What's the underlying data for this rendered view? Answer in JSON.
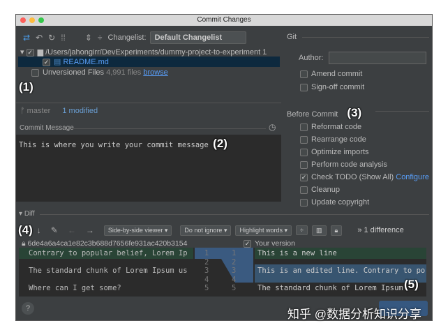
{
  "window": {
    "title": "Commit Changes"
  },
  "toolbar": {
    "changelist_label": "Changelist:",
    "changelist_value": "Default Changelist"
  },
  "tree": {
    "root_path": "/Users/jahongirr/DevExperiments/dummy-project-to-experiment",
    "root_count": "1",
    "file": "README.md",
    "unversioned_label": "Unversioned Files",
    "unversioned_count": "4,991 files",
    "browse": "browse"
  },
  "status": {
    "branch": "master",
    "modified": "1 modified"
  },
  "commit": {
    "label": "Commit Message",
    "text": "This is where you write your commit message"
  },
  "git": {
    "title": "Git",
    "author_label": "Author:",
    "author_value": "",
    "amend": "Amend commit",
    "signoff": "Sign-off commit"
  },
  "before_commit": {
    "title": "Before Commit",
    "items": [
      {
        "label": "Reformat code",
        "checked": false
      },
      {
        "label": "Rearrange code",
        "checked": false
      },
      {
        "label": "Optimize imports",
        "checked": false
      },
      {
        "label": "Perform code analysis",
        "checked": false
      },
      {
        "label": "Check TODO (Show All)",
        "checked": true,
        "link": "Configure"
      },
      {
        "label": "Cleanup",
        "checked": false
      },
      {
        "label": "Update copyright",
        "checked": false
      }
    ]
  },
  "diff": {
    "title": "Diff",
    "viewer": "Side-by-side viewer",
    "ignore": "Do not ignore",
    "highlight": "Highlight words",
    "count": "1 difference",
    "left_header": "6de4a6a4ca1e82c3b688d7656fe931ac420b3154",
    "right_header": "Your version",
    "left_lines": [
      "Contrary to popular belief, Lorem Ip",
      "",
      "The standard chunk of Lorem Ipsum us",
      "",
      "Where can I get some?"
    ],
    "right_lines": [
      "This is a new line",
      "",
      "This is an edited line. Contrary to po",
      "",
      "The standard chunk of Lorem Ipsum"
    ],
    "line_numbers": [
      "1",
      "2",
      "3",
      "4",
      "5"
    ]
  },
  "annotations": [
    "(1)",
    "(2)",
    "(3)",
    "(4)",
    "(5)"
  ],
  "footer": {
    "help": "?"
  },
  "watermark": "知乎 @数据分析知识分享"
}
